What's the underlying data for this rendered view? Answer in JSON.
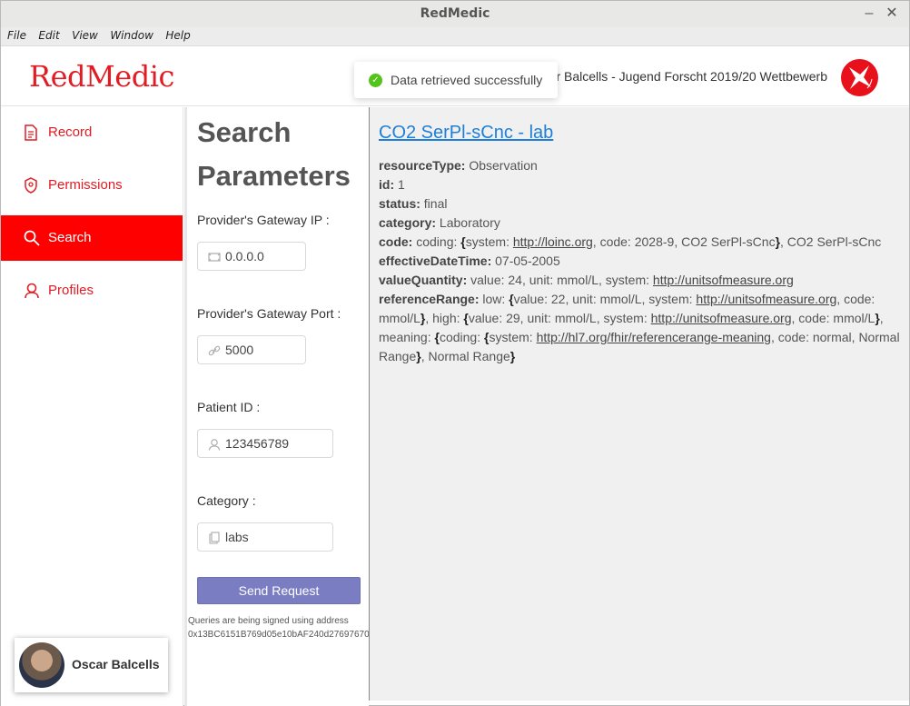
{
  "window": {
    "title": "RedMedic",
    "minimize": "–",
    "close": "✕"
  },
  "menu": [
    "File",
    "Edit",
    "View",
    "Window",
    "Help"
  ],
  "header": {
    "logo": "RedMedic",
    "text": "r Balcells - Jugend Forscht 2019/20 Wettbewerb",
    "badge_icon": "jugend-forscht-logo-icon"
  },
  "toast": {
    "message": "Data retrieved successfully",
    "icon": "check-circle-icon"
  },
  "sidebar": {
    "items": [
      {
        "label": "Record",
        "icon": "file-icon"
      },
      {
        "label": "Permissions",
        "icon": "shield-icon"
      },
      {
        "label": "Search",
        "icon": "search-icon"
      },
      {
        "label": "Profiles",
        "icon": "user-icon"
      }
    ],
    "active": "Search",
    "user": {
      "name": "Oscar Balcells"
    }
  },
  "search": {
    "title": "Search Parameters",
    "fields": [
      {
        "label": "Provider's Gateway IP",
        "value": "0.0.0.0",
        "icon": "ip-icon"
      },
      {
        "label": "Provider's Gateway Port",
        "value": "5000",
        "icon": "link-icon"
      },
      {
        "label": "Patient ID",
        "value": "123456789",
        "icon": "user-icon"
      },
      {
        "label": "Category",
        "value": "labs",
        "icon": "copy-icon"
      }
    ],
    "send_label": "Send Request",
    "sign_note_line1": "Queries are being signed using address",
    "sign_note_line2": "0x13BC6151B769d05e10bAF240d27697670"
  },
  "result": {
    "title": "CO2 SerPl-sCnc - lab",
    "resourceType": "Observation",
    "id": "1",
    "status": "final",
    "category": "Laboratory",
    "code": {
      "system": "http://loinc.org",
      "code": "2028-9",
      "display": "CO2 SerPl-sCnc",
      "text": "CO2 SerPl-sCnc"
    },
    "effectiveDateTime": "07-05-2005",
    "valueQuantity": {
      "value": "24",
      "unit": "mmol/L",
      "system": "http://unitsofmeasure.org"
    },
    "referenceRange": {
      "low": {
        "value": "22",
        "unit": "mmol/L",
        "system": "http://unitsofmeasure.org",
        "code": "mmol/L"
      },
      "high": {
        "value": "29",
        "unit": "mmol/L",
        "system": "http://unitsofmeasure.org",
        "code": "mmol/L"
      },
      "meaning": {
        "system": "http://hl7.org/fhir/referencerange-meaning",
        "code": "normal",
        "display": "Normal Range",
        "text": "Normal Range"
      }
    }
  },
  "colors": {
    "brand": "#e21c24",
    "active_bg": "#ff0000",
    "button": "#7b7dc2",
    "link": "#1f7fd6",
    "success": "#52c41a"
  }
}
